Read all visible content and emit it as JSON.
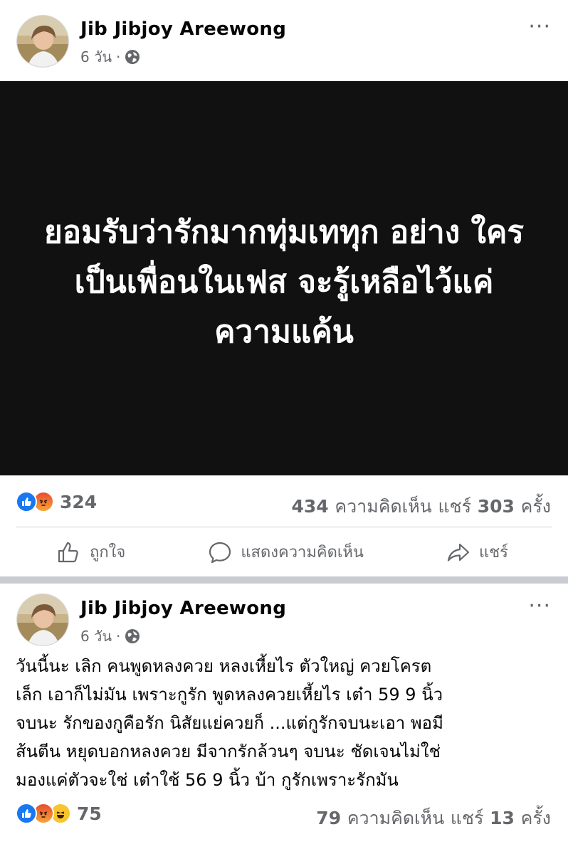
{
  "post1": {
    "author": "Jib Jibjoy Areewong",
    "time": "6 วัน",
    "dot": "·",
    "more": "···",
    "card_text": "ยอมรับว่ารักมากทุ่มเททุก อย่าง ใครเป็นเพื่อนในเฟส จะรู้เหลือไว้แค่ความแค้น",
    "reaction_count": "324",
    "comments_num": "434",
    "comments_label": "ความคิดเห็น",
    "shares_label": "แชร์",
    "shares_num": "303",
    "shares_unit": "ครั้ง",
    "actions": {
      "like": "ถูกใจ",
      "comment": "แสดงความคิดเห็น",
      "share": "แชร์"
    }
  },
  "post2": {
    "author": "Jib Jibjoy Areewong",
    "time": "6 วัน",
    "dot": "·",
    "more": "···",
    "text": "วันนี้นะ เลิก คนพูดหลงควย หลงเหี้ยไร ตัวใหญ่ ควยโครต\nเล็ก เอาก็ไม่มัน เพราะกูรัก พูดหลงควยเหี้ยไร เต๋า 59 9 นิ้ว\nจบนะ รักของกูคือรัก นิสัยแย่ควยก็ ...แต่กูรักจบนะเอา พอมี\nส้นตีน หยุดบอกหลงควย มีจากรักล้วนๆ จบนะ ชัดเจนไม่ใช่\nมองแค่ตัวจะใช่ เต๋าใช้ 56 9 นิ้ว บ้า กูรักเพราะรักมัน",
    "reaction_count": "75",
    "comments_num": "79",
    "comments_label": "ความคิดเห็น",
    "shares_label": "แชร์",
    "shares_num": "13",
    "shares_unit": "ครั้ง"
  },
  "colors": {
    "like": "#1877f2",
    "secondary_text": "#65676b",
    "card_bg": "#111111",
    "separator": "#c9ccd1"
  }
}
